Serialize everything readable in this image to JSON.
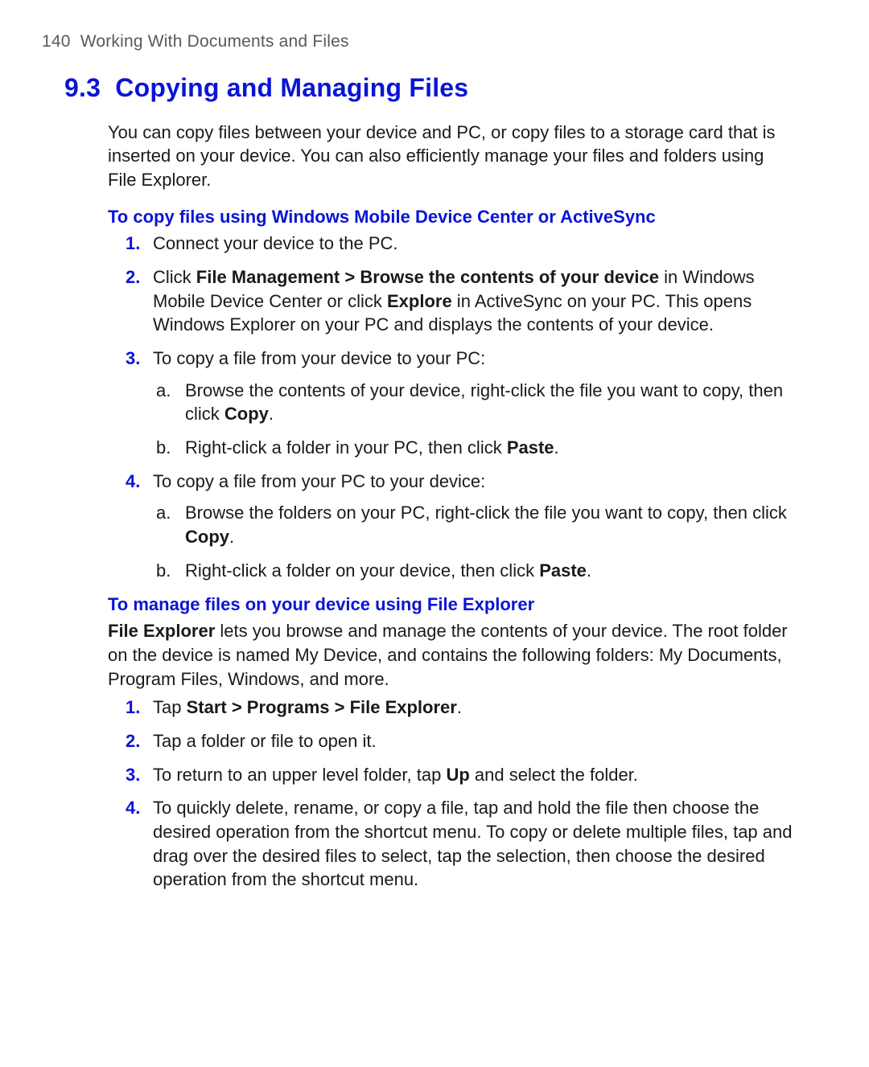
{
  "page_header": {
    "num": "140",
    "title": "Working With Documents and Files"
  },
  "section": {
    "number": "9.3",
    "title": "Copying and Managing Files"
  },
  "intro": "You can copy files between your device and PC, or copy files to a storage card that is inserted on your device. You can also efficiently manage your files and folders using File Explorer.",
  "sub1": {
    "heading": "To copy files using Windows Mobile Device Center or ActiveSync",
    "items": [
      {
        "m": "1.",
        "text": "Connect your device to the PC."
      },
      {
        "m": "2.",
        "pre": "Click ",
        "b1": "File Management > Browse the contents of your device",
        "mid1": " in Windows Mobile Device Center or click ",
        "b2": "Explore",
        "mid2": " in ActiveSync on your PC. This opens Windows Explorer on your PC and displays the contents of your device."
      },
      {
        "m": "3.",
        "text": "To copy a file from your device to your PC:",
        "sub": [
          {
            "m": "a.",
            "pre": "Browse the contents of your device, right-click the file you want to copy, then click ",
            "b": "Copy",
            "post": "."
          },
          {
            "m": "b.",
            "pre": "Right-click a folder in your PC, then click ",
            "b": "Paste",
            "post": "."
          }
        ]
      },
      {
        "m": "4.",
        "text": "To copy a file from your PC to your device:",
        "sub": [
          {
            "m": "a.",
            "pre": "Browse the folders on your PC, right-click the file you want to copy, then click ",
            "b": "Copy",
            "post": "."
          },
          {
            "m": "b.",
            "pre": "Right-click a folder on your device, then click ",
            "b": "Paste",
            "post": "."
          }
        ]
      }
    ]
  },
  "sub2": {
    "heading": "To manage files on your device using File Explorer",
    "lead_b": "File Explorer",
    "lead_rest": " lets you browse and manage the contents of your device. The root folder on the device is named My Device, and contains the following folders: My Documents, Program Files, Windows, and more.",
    "items": [
      {
        "m": "1.",
        "pre": "Tap ",
        "b": "Start > Programs > File Explorer",
        "post": "."
      },
      {
        "m": "2.",
        "text": "Tap a folder or file to open it."
      },
      {
        "m": "3.",
        "pre": "To return to an upper level folder, tap ",
        "b": "Up",
        "post": " and select the folder."
      },
      {
        "m": "4.",
        "text": "To quickly delete, rename, or copy a file, tap and hold the file then choose the desired operation from the shortcut menu. To copy or delete multiple files, tap and drag over the desired files to select, tap the selection, then choose the desired operation from the shortcut menu."
      }
    ]
  }
}
